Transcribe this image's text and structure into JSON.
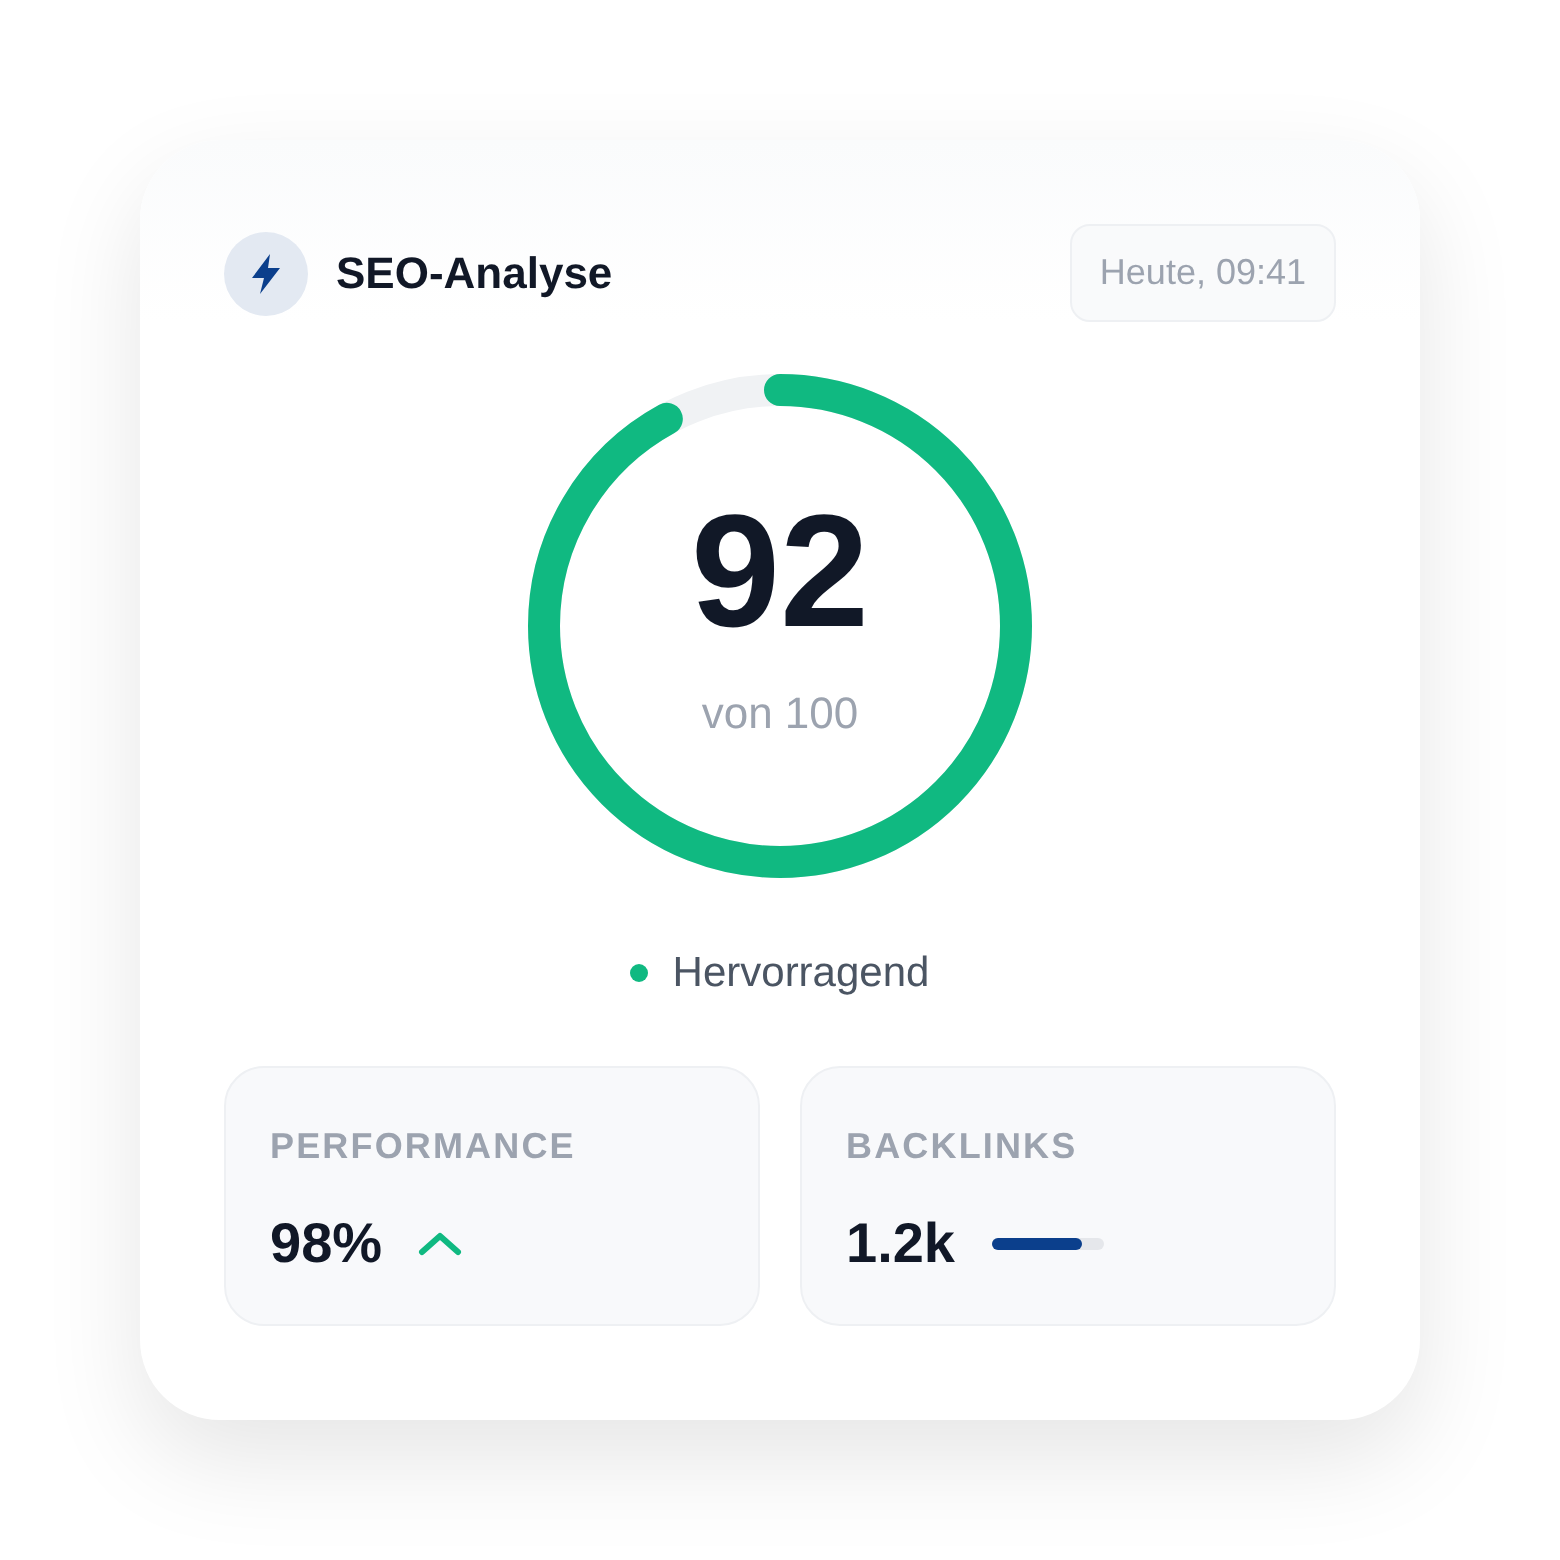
{
  "header": {
    "title": "SEO-Analyse",
    "timestamp": "Heute, 09:41"
  },
  "score": {
    "value": "92",
    "caption": "von 100"
  },
  "status": {
    "label": "Hervorragend",
    "color": "#10b981"
  },
  "metrics": [
    {
      "kind": "trend",
      "label": "PERFORMANCE",
      "value": "98%"
    },
    {
      "kind": "bar",
      "label": "BACKLINKS",
      "value": "1.2k",
      "level": 0.82
    }
  ]
}
